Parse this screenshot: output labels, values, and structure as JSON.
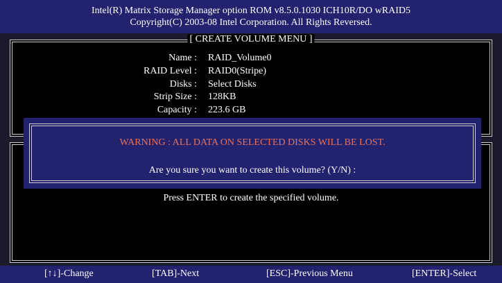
{
  "header": {
    "line1": "Intel(R) Matrix Storage Manager option ROM v8.5.0.1030 ICH10R/DO wRAID5",
    "line2": "Copyright(C) 2003-08 Intel Corporation.  All Rights Reversed."
  },
  "create_menu": {
    "title": "[ CREATE VOLUME MENU ]",
    "fields": [
      {
        "label": "Name :",
        "value": "RAID_Volume0"
      },
      {
        "label": "RAID Level :",
        "value": "RAID0(Stripe)"
      },
      {
        "label": "Disks :",
        "value": "Select Disks"
      },
      {
        "label": "Strip Size :",
        "value": "128KB"
      },
      {
        "label": "Capacity :",
        "value": "223.6 GB"
      }
    ]
  },
  "help_panel": {
    "text": "Press ENTER to create the specified volume."
  },
  "dialog": {
    "warning": "WARNING : ALL DATA ON SELECTED DISKS WILL BE LOST.",
    "question": "Are you sure you want to create this volume? (Y/N) :"
  },
  "footer": {
    "change": "[↑↓]-Change",
    "next": "[TAB]-Next",
    "previous": "[ESC]-Previous Menu",
    "select": "[ENTER]-Select"
  },
  "colors": {
    "background": "#000000",
    "header_bg": "#22226e",
    "warning_text": "#e8735a",
    "border": "#cfcfcf"
  }
}
